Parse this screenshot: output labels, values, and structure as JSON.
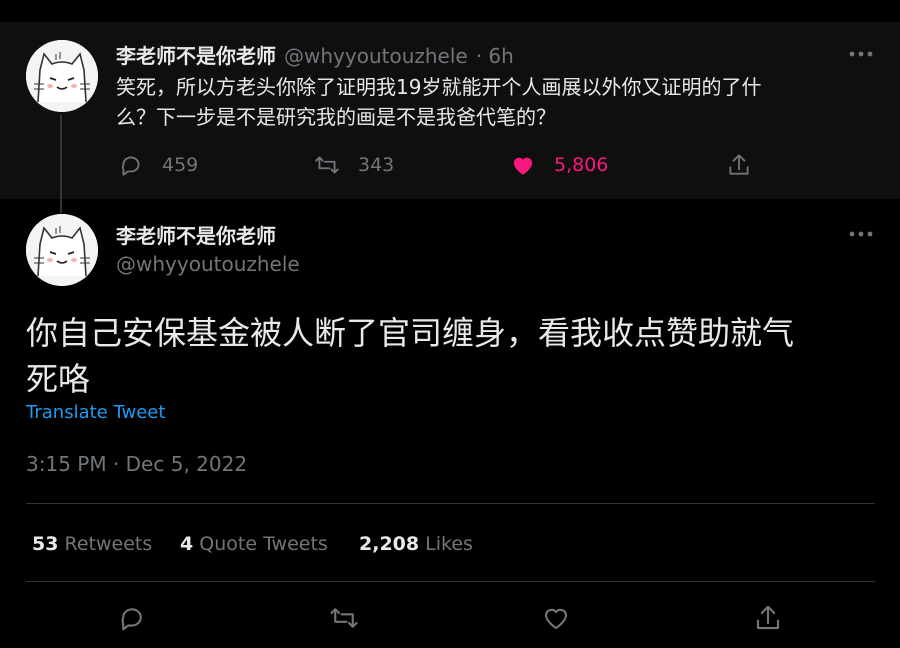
{
  "parent_tweet": {
    "author_name": "李老师不是你老师",
    "handle": "@whyyoutouzhele",
    "time": "· 6h",
    "text_line1": "笑死，所以方老头你除了证明我19岁就能开个人画展以外你又证明的了什",
    "text_line2": "么？下一步是不是研究我的画是不是我爸代笔的？",
    "reply_count": "459",
    "retweet_count": "343",
    "like_count": "5,806"
  },
  "main_tweet": {
    "author_name": "李老师不是你老师",
    "handle": "@whyyoutouzhele",
    "text_line1": "你自己安保基金被人断了官司缠身，看我收点赞助就气",
    "text_line2": "死咯",
    "translate_label": "Translate Tweet",
    "timestamp": "3:15 PM · Dec 5, 2022"
  },
  "stats": {
    "retweets_count": "53",
    "retweets_label": "Retweets",
    "quotes_count": "4",
    "quotes_label": "Quote Tweets",
    "likes_count": "2,208",
    "likes_label": "Likes"
  },
  "colors": {
    "background": "#000000",
    "parent_background": "#0f0f10",
    "text": "#e7e9ea",
    "muted": "#71767b",
    "like_pink": "#f91880",
    "link_blue": "#1d9bf0"
  },
  "icons": [
    "reply-icon",
    "retweet-icon",
    "heart-icon",
    "share-icon",
    "more-icon",
    "avatar-cat"
  ]
}
